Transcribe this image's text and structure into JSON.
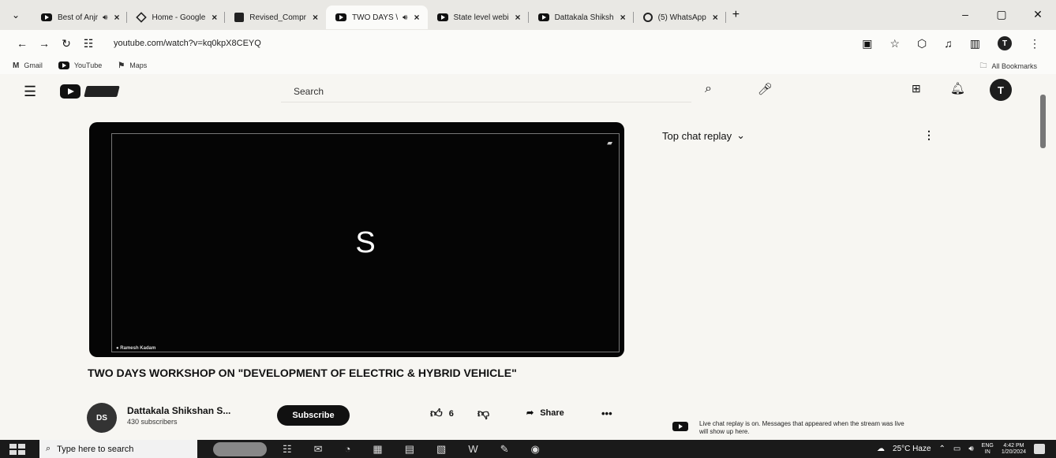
{
  "browser": {
    "tabs": [
      {
        "title": "Best of Anjr",
        "favicon": "youtube-icon",
        "audio": true
      },
      {
        "title": "Home - Google",
        "favicon": "drive-icon",
        "audio": false
      },
      {
        "title": "Revised_Compr",
        "favicon": "doc-icon",
        "audio": false
      },
      {
        "title": "TWO DAYS \\",
        "favicon": "youtube-icon",
        "audio": true,
        "active": true
      },
      {
        "title": "State level webi",
        "favicon": "youtube-icon",
        "audio": false
      },
      {
        "title": "Dattakala Shiksh",
        "favicon": "youtube-icon",
        "audio": false
      },
      {
        "title": "(5) WhatsApp",
        "favicon": "whatsapp-icon",
        "audio": false
      }
    ],
    "url": "youtube.com/watch?v=kq0kpX8CEYQ",
    "bookmarks": [
      "Gmail",
      "YouTube",
      "Maps"
    ],
    "all_bookmarks": "All Bookmarks",
    "profile_initial": "T"
  },
  "youtube": {
    "search_placeholder": "Search",
    "avatar_initial": "T",
    "video": {
      "screen_letter": "S",
      "caption": "Ramesh Kadam",
      "title": "TWO DAYS WORKSHOP ON \"DEVELOPMENT OF ELECTRIC & HYBRID VEHICLE\"",
      "channel_name": "Dattakala Shikshan S...",
      "subscribers": "430 subscribers",
      "subscribe_label": "Subscribe",
      "likes": "6",
      "share_label": "Share"
    },
    "chat": {
      "header": "Top chat replay",
      "notice": "Live chat replay is on. Messages that appeared when the stream was live will show up here."
    }
  },
  "taskbar": {
    "search_placeholder": "Type here to search",
    "weather": "25°C  Haze",
    "lang_top": "ENG",
    "lang_bottom": "IN",
    "time": "4:42 PM",
    "date": "1/20/2024"
  }
}
